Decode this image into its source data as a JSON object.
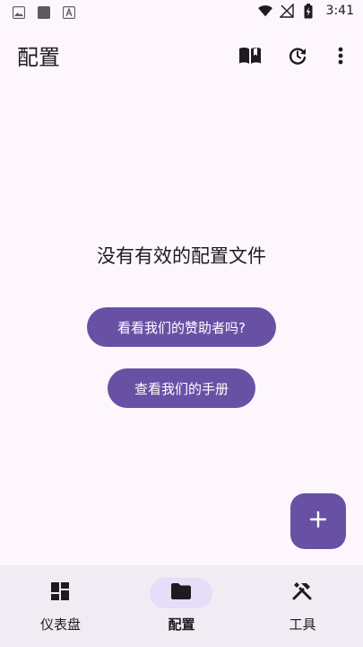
{
  "status_bar": {
    "time": "3:41"
  },
  "app_bar": {
    "title": "配置"
  },
  "empty_state": {
    "title": "没有有效的配置文件",
    "sponsor_button": "看看我们的赞助者吗?",
    "manual_button": "查看我们的手册"
  },
  "bottom_nav": {
    "items": [
      {
        "label": "仪表盘",
        "icon": "dashboard-icon"
      },
      {
        "label": "配置",
        "icon": "folder-icon"
      },
      {
        "label": "工具",
        "icon": "tools-icon"
      }
    ],
    "selected": "配置"
  },
  "colors": {
    "background": "#fdf7fd",
    "accent": "#6851a5",
    "nav_background": "#f1ecf4",
    "nav_indicator": "#e6def8"
  }
}
